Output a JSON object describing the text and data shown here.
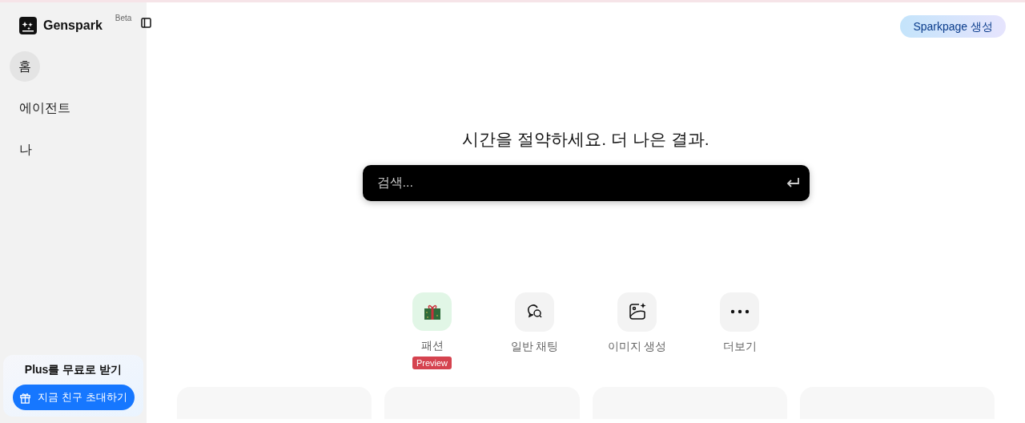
{
  "sidebar": {
    "logo": "Genspark",
    "beta": "Beta",
    "items": [
      {
        "label": "홈",
        "selected": true
      },
      {
        "label": "에이전트",
        "selected": false
      },
      {
        "label": "나",
        "selected": false
      }
    ],
    "promo": {
      "title": "Plus를 무료로 받기",
      "button": "지금 친구 초대하기"
    }
  },
  "header": {
    "button": "Sparkpage 생성"
  },
  "main": {
    "headline": "시간을 절약하세요. 더 나은 결과.",
    "search": {
      "placeholder": "검색..."
    },
    "actions": [
      {
        "kind": "gift",
        "label": "패션",
        "badge": "Preview"
      },
      {
        "kind": "chat",
        "label": "일반 채팅"
      },
      {
        "kind": "image",
        "label": "이미지 생성"
      },
      {
        "kind": "more",
        "label": "더보기"
      }
    ],
    "cards": [
      {
        "kind": "card"
      },
      {
        "kind": "card"
      },
      {
        "kind": "card"
      },
      {
        "kind": "card"
      }
    ]
  }
}
